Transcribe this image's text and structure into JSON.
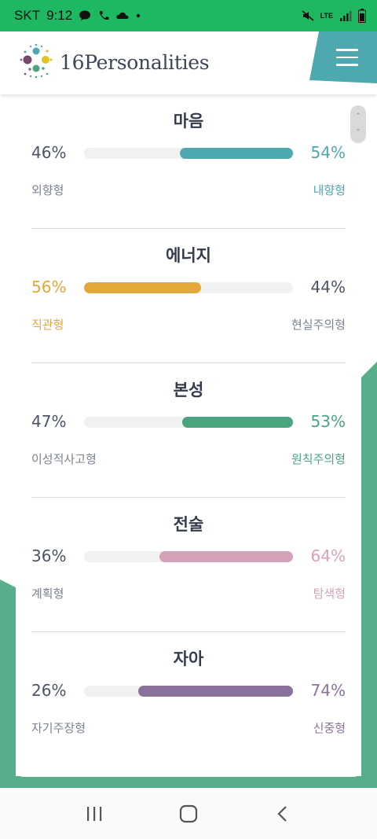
{
  "status_bar": {
    "carrier": "SKT",
    "time": "9:12",
    "network": "LTE"
  },
  "header": {
    "logo_text": "16Personalities",
    "menu_icon": "hamburger-menu-icon"
  },
  "colors": {
    "teal": "#4ea8b0",
    "yellow": "#e3a73a",
    "green": "#4aa57f",
    "pink": "#d5a1b9",
    "purple": "#8b729b",
    "bg_green": "#58ad8a"
  },
  "traits": [
    {
      "title": "마음",
      "left_pct": "46%",
      "right_pct": "54%",
      "left_label": "외향형",
      "right_label": "내향형",
      "dominant": "right",
      "fill_fraction": 0.54,
      "color": "#4ea8b0"
    },
    {
      "title": "에너지",
      "left_pct": "56%",
      "right_pct": "44%",
      "left_label": "직관형",
      "right_label": "현실주의형",
      "dominant": "left",
      "fill_fraction": 0.56,
      "color": "#e3a73a"
    },
    {
      "title": "본성",
      "left_pct": "47%",
      "right_pct": "53%",
      "left_label": "이성적사고형",
      "right_label": "원칙주의형",
      "dominant": "right",
      "fill_fraction": 0.53,
      "color": "#4aa57f"
    },
    {
      "title": "전술",
      "left_pct": "36%",
      "right_pct": "64%",
      "left_label": "계획형",
      "right_label": "탐색형",
      "dominant": "right",
      "fill_fraction": 0.64,
      "color": "#d5a1b9"
    },
    {
      "title": "자아",
      "left_pct": "26%",
      "right_pct": "74%",
      "left_label": "자기주장형",
      "right_label": "신중형",
      "dominant": "right",
      "fill_fraction": 0.74,
      "color": "#8b729b"
    }
  ],
  "nav_bar": {
    "recent": "recent-apps-icon",
    "home": "home-icon",
    "back": "back-icon"
  }
}
